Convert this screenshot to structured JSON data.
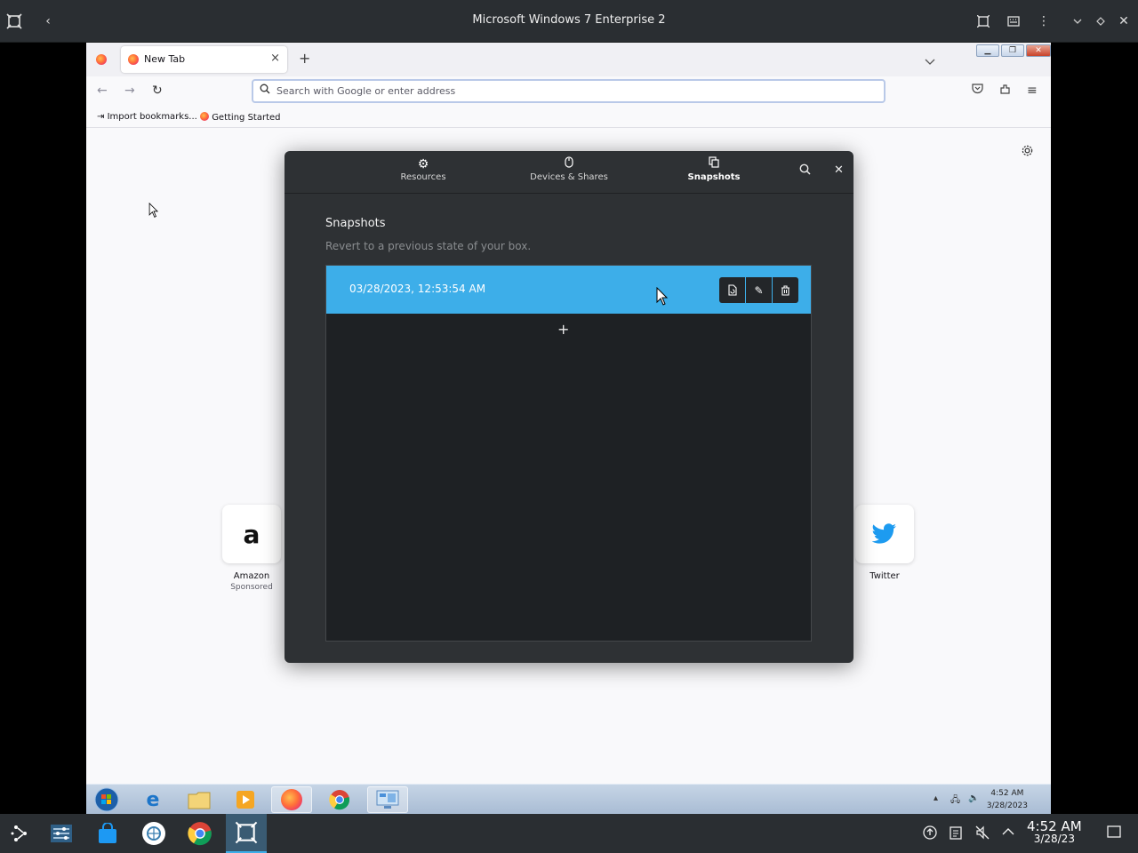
{
  "host": {
    "title": "Microsoft Windows 7 Enterprise 2"
  },
  "firefox": {
    "tab_label": "New Tab",
    "new_tab": "+",
    "search_placeholder": "Search with Google or enter address",
    "bookmarks": [
      "Import bookmarks...",
      "Getting Started"
    ],
    "shortcuts": [
      {
        "label": "Amazon",
        "sub": "Sponsored",
        "glyph": "a"
      },
      {
        "label": "Twitter",
        "sub": "",
        "glyph": "twitter-bird"
      }
    ]
  },
  "dialog": {
    "tabs": [
      {
        "label": "Resources",
        "icon": "gear-icon"
      },
      {
        "label": "Devices & Shares",
        "icon": "mouse-icon"
      },
      {
        "label": "Snapshots",
        "icon": "copy-icon"
      }
    ],
    "active_tab": "Snapshots",
    "heading": "Snapshots",
    "subtitle": "Revert to a previous state of your box.",
    "snapshots": [
      {
        "date": "03/28/2023, 12:53:54 AM"
      }
    ],
    "add_label": "+"
  },
  "vm_taskbar": {
    "clock_time": "4:52 AM",
    "clock_date": "3/28/2023"
  },
  "host_taskbar": {
    "clock_time": "4:52 AM",
    "clock_date": "3/28/23"
  },
  "colors": {
    "accent": "#3daee9",
    "dialog_bg": "#2e3134",
    "host_bar": "#2a2e32"
  }
}
